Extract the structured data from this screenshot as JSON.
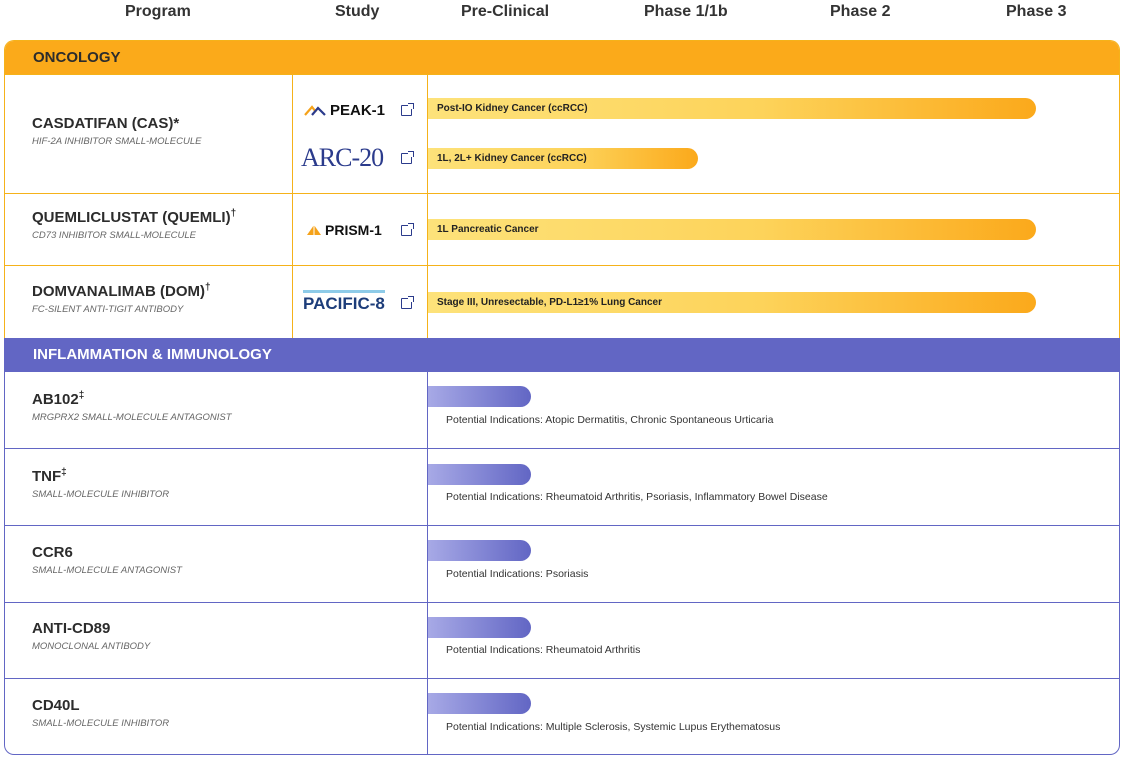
{
  "columns": [
    "Program",
    "Study",
    "Pre-Clinical",
    "Phase 1/1b",
    "Phase 2",
    "Phase 3"
  ],
  "oncology": {
    "title": "ONCOLOGY",
    "programs": [
      {
        "name": "CASDATIFAN (CAS)*",
        "desc": "HIF-2α INHIBITOR SMALL-MOLECULE",
        "studies": [
          {
            "logo": "PEAK-1",
            "indication": "Post-IO Kidney Cancer (ccRCC)",
            "progress_pct": 100
          },
          {
            "logo": "ARC-20",
            "indication": "1L, 2L+ Kidney Cancer (ccRCC)",
            "progress_pct": 44
          }
        ]
      },
      {
        "name": "QUEMLICLUSTAT (QUEMLI)",
        "mark": "†",
        "desc": "CD73 INHIBITOR SMALL-MOLECULE",
        "studies": [
          {
            "logo": "PRISM-1",
            "indication": "1L Pancreatic Cancer",
            "progress_pct": 100
          }
        ]
      },
      {
        "name": "DOMVANALIMAB (DOM)",
        "mark": "†",
        "desc": "FC-SILENT ANTI-TIGIT ANTIBODY",
        "studies": [
          {
            "logo": "PACIFIC-8",
            "indication": "Stage III, Unresectable, PD-L1≥1% Lung Cancer",
            "progress_pct": 100
          }
        ]
      }
    ]
  },
  "immunology": {
    "title": "INFLAMMATION & IMMUNOLOGY",
    "programs": [
      {
        "name": "AB102",
        "mark": "‡",
        "desc": "MRGPRX2 SMALL-MOLECULE ANTAGONIST",
        "indication": "Potential Indications: Atopic Dermatitis, Chronic Spontaneous Urticaria"
      },
      {
        "name": "TNF",
        "mark": "‡",
        "desc": "SMALL-MOLECULE INHIBITOR",
        "indication": "Potential Indications: Rheumatoid Arthritis, Psoriasis, Inflammatory Bowel Disease"
      },
      {
        "name": "CCR6",
        "desc": "SMALL-MOLECULE ANTAGONIST",
        "indication": "Potential Indications: Psoriasis"
      },
      {
        "name": "ANTI-CD89",
        "desc": "MONOCLONAL ANTIBODY",
        "indication": "Potential Indications: Rheumatoid Arthritis"
      },
      {
        "name": "CD40L",
        "desc": "SMALL-MOLECULE INHIBITOR",
        "indication": "Potential Indications: Multiple Sclerosis, Systemic Lupus Erythematosus"
      }
    ]
  },
  "colors": {
    "oncology": "#fbaa1a",
    "immunology": "#6266c4"
  },
  "icons": [
    "external-link-icon",
    "peak-logo-icon",
    "prism-logo-icon"
  ]
}
